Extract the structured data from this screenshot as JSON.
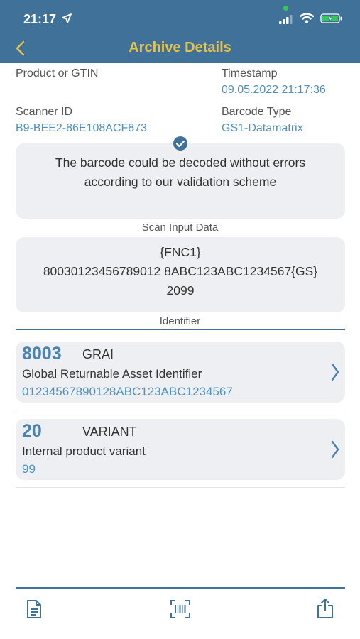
{
  "status_bar": {
    "time": "21:17"
  },
  "nav": {
    "title": "Archive Details",
    "back_icon": "chevron-left-icon"
  },
  "info": {
    "product_label": "Product or GTIN",
    "timestamp_label": "Timestamp",
    "timestamp_value": "09.05.2022 21:17:36",
    "scanner_label": "Scanner ID",
    "scanner_value": "B9-BEE2-86E108ACF873",
    "barcode_type_label": "Barcode Type",
    "barcode_type_value": "GS1-Datamatrix"
  },
  "validation": {
    "line1": "The barcode could be decoded without errors",
    "line2": "according to our validation scheme"
  },
  "scan_input": {
    "label": "Scan Input Data",
    "line1": "{FNC1}",
    "line2": "80030123456789012 8ABC123ABC1234567{GS}",
    "line3": "2099"
  },
  "identifier": {
    "label": "Identifier",
    "items": [
      {
        "code": "8003",
        "abbr": "GRAI",
        "description": "Global Returnable Asset Identifier",
        "value": "01234567890128ABC123ABC1234567"
      },
      {
        "code": "20",
        "abbr": "VARIANT",
        "description": "Internal product variant",
        "value": "99"
      }
    ]
  },
  "colors": {
    "header": "#3f7199",
    "title": "#e6c24a",
    "accent": "#4e90bf"
  },
  "tab_bar": {
    "icons": [
      "document-icon",
      "barcode-scan-icon",
      "share-icon"
    ]
  }
}
